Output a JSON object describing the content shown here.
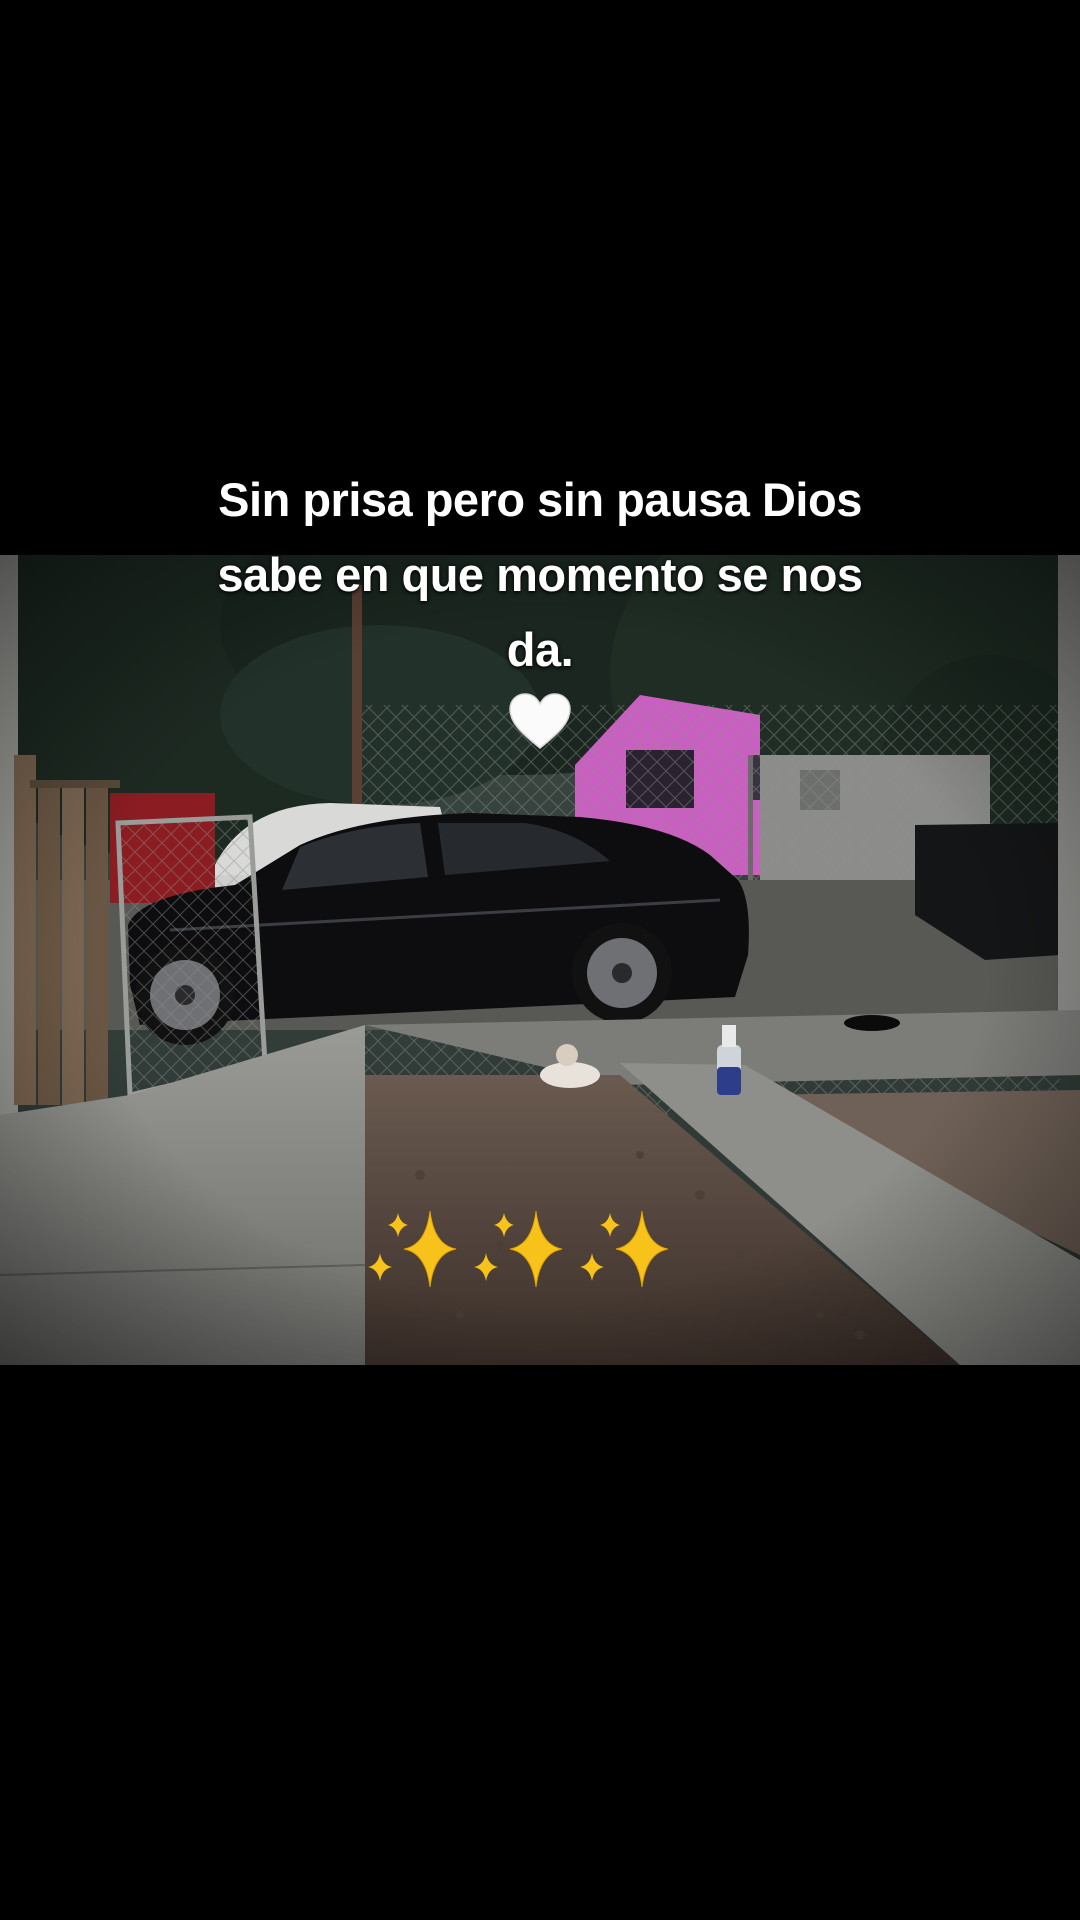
{
  "caption": {
    "line1": "Sin prisa pero sin pausa Dios",
    "line2": "sabe en que momento se nos",
    "line3": "da."
  },
  "emojis": {
    "heart": "white-heart",
    "sparkles": [
      "sparkles",
      "sparkles",
      "sparkles"
    ]
  },
  "colors": {
    "background": "#000000",
    "caption_text": "#ffffff",
    "wall_pink": "#c95fc0",
    "sparkle_yellow": "#f7c21a"
  }
}
